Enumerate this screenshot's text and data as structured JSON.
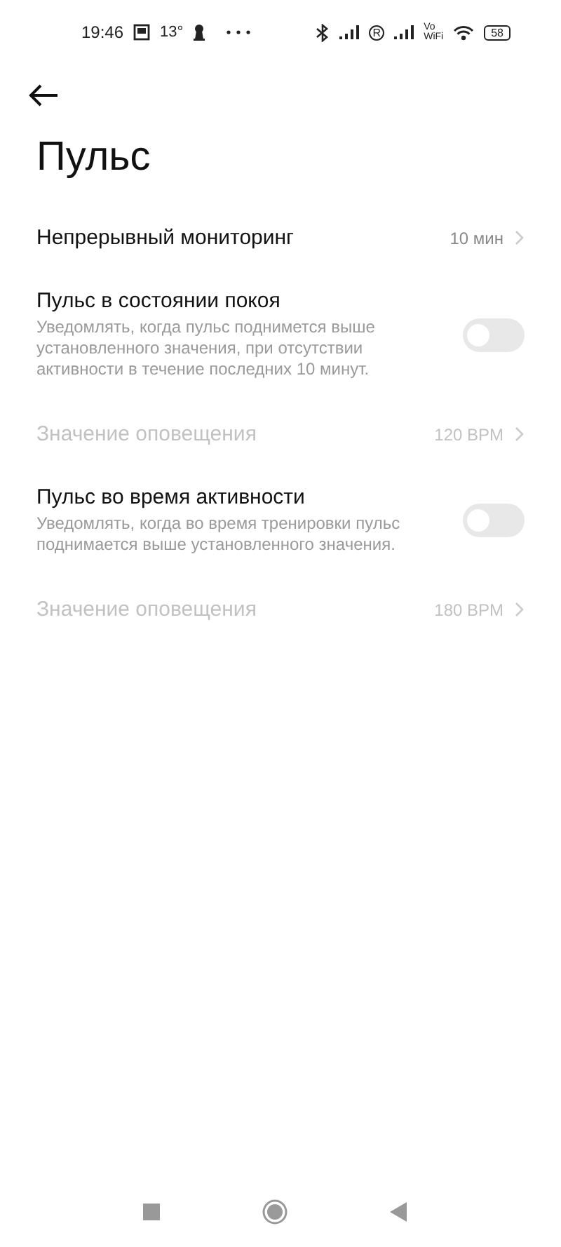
{
  "status_bar": {
    "time": "19:46",
    "temperature": "13°",
    "roaming": "R",
    "volte": [
      "Vo",
      "WiFi"
    ],
    "battery": "58"
  },
  "title": "Пульс",
  "settings": [
    {
      "kind": "link",
      "label": "Непрерывный мониторинг",
      "value": "10 мин",
      "disabled": false
    },
    {
      "kind": "toggle",
      "label": "Пульс в состоянии покоя",
      "description": "Уведомлять, когда пульс поднимется выше установленного значения, при отсутствии активности в течение последних 10 минут.",
      "on": false
    },
    {
      "kind": "link",
      "label": "Значение оповещения",
      "value": "120 BPM",
      "disabled": true
    },
    {
      "kind": "toggle",
      "label": "Пульс во время активности",
      "description": "Уведомлять, когда во время тренировки пульс поднимается выше установленного значения.",
      "on": false
    },
    {
      "kind": "link",
      "label": "Значение оповещения",
      "value": "180 BPM",
      "disabled": true
    }
  ]
}
